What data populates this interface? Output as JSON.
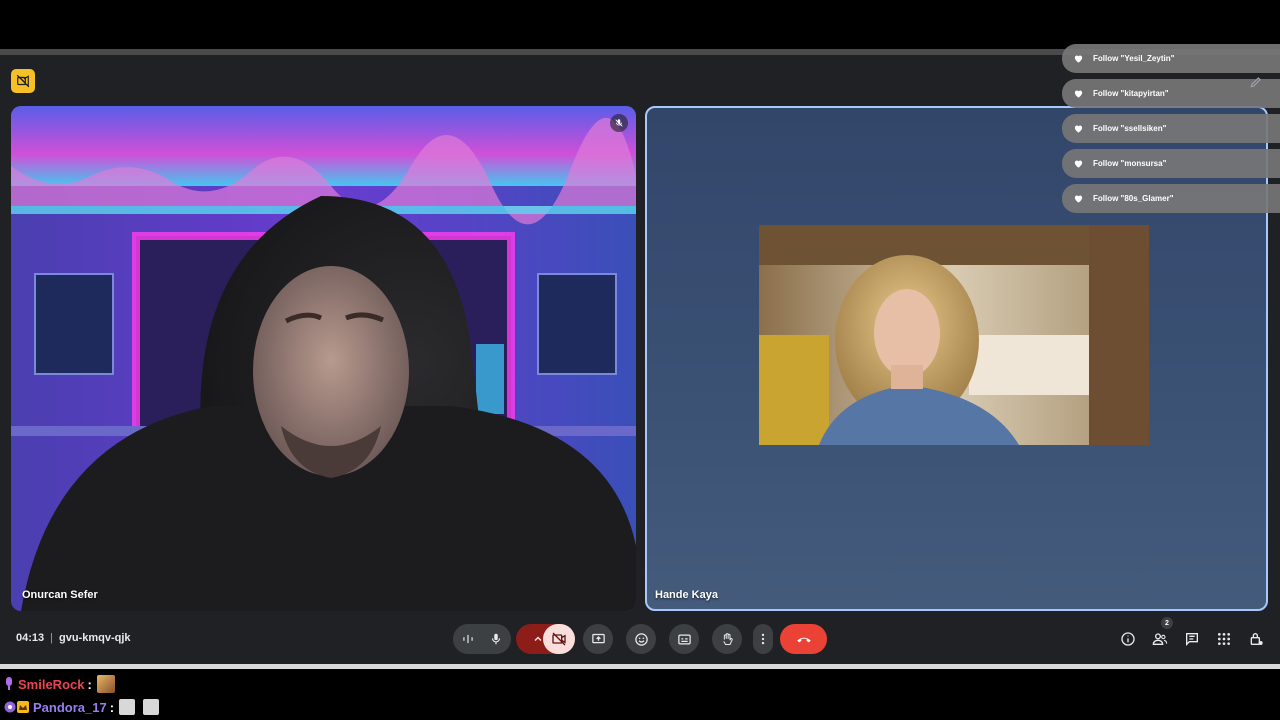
{
  "meeting": {
    "time": "04:13",
    "separator": "|",
    "code": "gvu-kmqv-qjk",
    "people_count": "2"
  },
  "participants": [
    {
      "name": "Onurcan Sefer",
      "muted": true
    },
    {
      "name": "Hande Kaya",
      "muted": false
    }
  ],
  "follow_notifications": [
    {
      "text": "Follow \"Yesil_Zeytin\""
    },
    {
      "text": "Follow \"kitapyirtan\""
    },
    {
      "text": "Follow \"ssellsiken\""
    },
    {
      "text": "Follow \"monsursa\""
    },
    {
      "text": "Follow \"80s_Glamer\""
    }
  ],
  "controls": {
    "icons": [
      "audio-levels-icon",
      "mic-icon",
      "chevron-up-icon",
      "camera-off-icon",
      "present-icon",
      "emoji-icon",
      "captions-icon",
      "raise-hand-icon",
      "more-vert-icon",
      "end-call-icon"
    ],
    "right_icons": [
      "info-icon",
      "people-icon",
      "chat-icon",
      "activities-icon",
      "host-controls-icon"
    ]
  },
  "chat": [
    {
      "user": "SmileRock",
      "colon": ":"
    },
    {
      "user": "Pandora_17",
      "colon": ":"
    }
  ],
  "colors": {
    "background": "#202124",
    "end_call": "#ea4335",
    "camera_off_bg": "#f9dedc",
    "speaker_border": "#a8c7fa",
    "rec_badge": "#f6c026"
  }
}
